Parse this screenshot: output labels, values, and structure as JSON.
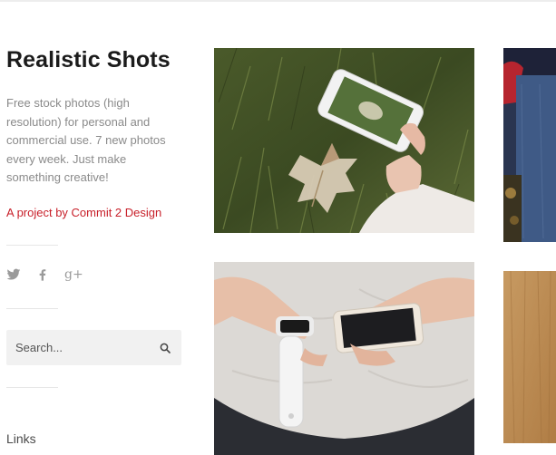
{
  "sidebar": {
    "title": "Realistic Shots",
    "description": "Free stock photos (high resolution) for personal and commercial use. 7 new photos every week. Just make something creative!",
    "project_link": "A project by Commit 2 Design",
    "social": [
      {
        "name": "twitter",
        "icon": "twitter-icon"
      },
      {
        "name": "facebook",
        "icon": "facebook-icon"
      },
      {
        "name": "google-plus",
        "icon": "google-plus-icon",
        "glyph": "g+"
      }
    ],
    "search": {
      "placeholder": "Search...",
      "icon": "search-icon"
    },
    "links_heading": "Links"
  },
  "photos": [
    {
      "subject": "hand holding smartphone over grass with maple leaf"
    },
    {
      "subject": "person in jeans and red sleeve, cropped"
    },
    {
      "subject": "hands holding smartwatch and smartphone"
    },
    {
      "subject": "wooden surface, cropped"
    }
  ],
  "colors": {
    "title": "#1b1b1b",
    "description": "#8a8a8a",
    "link": "#c8202a",
    "search_bg": "#f1f1f1",
    "icon": "#9a9a9a"
  }
}
